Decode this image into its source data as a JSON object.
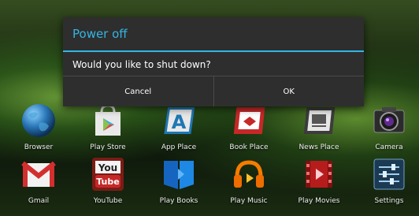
{
  "dialog": {
    "title": "Power off",
    "message": "Would you like to shut down?",
    "cancel_label": "Cancel",
    "ok_label": "OK",
    "accent_color": "#33b5e5"
  },
  "apps": [
    {
      "label": "Browser",
      "icon": "browser-globe-icon"
    },
    {
      "label": "Play Store",
      "icon": "play-store-icon"
    },
    {
      "label": "App Place",
      "icon": "app-place-icon"
    },
    {
      "label": "Book Place",
      "icon": "book-place-icon"
    },
    {
      "label": "News Place",
      "icon": "news-place-icon"
    },
    {
      "label": "Camera",
      "icon": "camera-icon"
    },
    {
      "label": "Gmail",
      "icon": "gmail-icon"
    },
    {
      "label": "YouTube",
      "icon": "youtube-icon"
    },
    {
      "label": "Play Books",
      "icon": "play-books-icon"
    },
    {
      "label": "Play Music",
      "icon": "play-music-icon"
    },
    {
      "label": "Play Movies",
      "icon": "play-movies-icon"
    },
    {
      "label": "Settings",
      "icon": "settings-icon"
    }
  ],
  "youtube_logo": {
    "line1": "You",
    "line2": "Tube"
  }
}
